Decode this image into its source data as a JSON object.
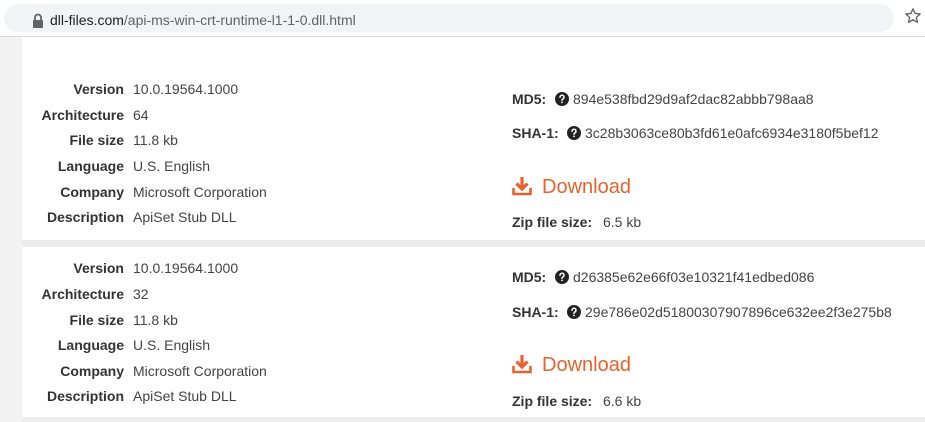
{
  "address_bar": {
    "domain": "dll-files.com",
    "path": "/api-ms-win-crt-runtime-l1-1-0.dll.html"
  },
  "colors": {
    "accent": "#e9622b",
    "page_bg": "#f2f2f2",
    "card_bg": "#ffffff"
  },
  "labels": {
    "version": "Version",
    "architecture": "Architecture",
    "file_size": "File size",
    "language": "Language",
    "company": "Company",
    "description": "Description",
    "md5": "MD5:",
    "sha1": "SHA-1:",
    "download": "Download",
    "zip_file_size": "Zip file size:"
  },
  "files": [
    {
      "version": "10.0.19564.1000",
      "architecture": "64",
      "file_size": "11.8 kb",
      "language": "U.S. English",
      "company": "Microsoft Corporation",
      "description": "ApiSet Stub DLL",
      "md5": "894e538fbd29d9af2dac82abbb798aa8",
      "sha1": "3c28b3063ce80b3fd61e0afc6934e3180f5bef12",
      "zip_file_size": "6.5 kb"
    },
    {
      "version": "10.0.19564.1000",
      "architecture": "32",
      "file_size": "11.8 kb",
      "language": "U.S. English",
      "company": "Microsoft Corporation",
      "description": "ApiSet Stub DLL",
      "md5": "d26385e62e66f03e10321f41edbed086",
      "sha1": "29e786e02d51800307907896ce632ee2f3e275b8",
      "zip_file_size": "6.6 kb"
    }
  ],
  "icons": {
    "lock": "lock-icon",
    "star": "star-icon",
    "help": "question-circle-icon",
    "download": "download-icon"
  }
}
